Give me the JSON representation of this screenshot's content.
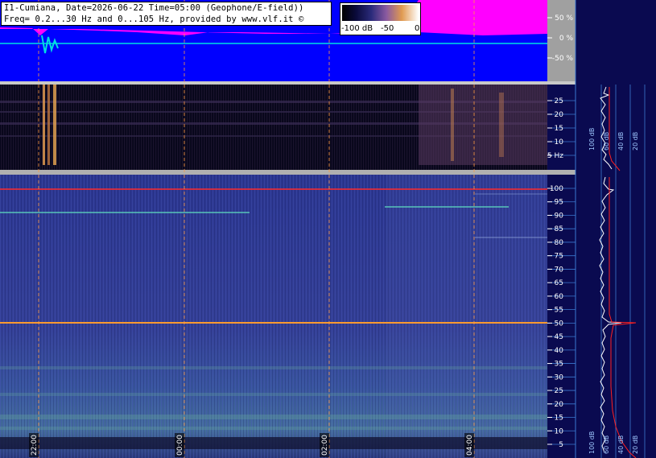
{
  "header": {
    "line1": "I1-Cumiana, Date=2026-06-22 Time=05:00 (Geophone/E-field))",
    "line2": "Freq= 0.2...30 Hz and 0...105 Hz, provided by www.vlf.it ©"
  },
  "colorbar": {
    "labels": [
      "-100 dB",
      "-50",
      "0"
    ]
  },
  "chart_data": [
    {
      "type": "line",
      "panel": "time-domain amplitude",
      "y_ticks": [
        "50 %",
        "0 %",
        "-50 %"
      ],
      "ylim": [
        -100,
        100
      ],
      "colors": {
        "background": "#0000ff",
        "envelope": "#ff00ff",
        "trace": "#00e0e0"
      }
    },
    {
      "type": "heatmap",
      "panel": "spectrogram 0.2-30 Hz",
      "y_ticks": [
        "25",
        "20",
        "15",
        "10",
        "5 Hz"
      ],
      "ylim": [
        0.2,
        30
      ]
    },
    {
      "type": "heatmap",
      "panel": "spectrogram 0-105 Hz",
      "y_ticks": [
        "100",
        "95",
        "90",
        "85",
        "80",
        "75",
        "70",
        "65",
        "60",
        "55",
        "50",
        "45",
        "40",
        "35",
        "30",
        "25",
        "20",
        "15",
        "10",
        "5"
      ],
      "ylim": [
        0,
        105
      ],
      "x_ticks": [
        "22:00",
        "00:00",
        "02:00",
        "04:00"
      ],
      "colors": {
        "background": "#2e3a8c",
        "line_100hz": "#ff2020",
        "line_50hz": "#ffaa30",
        "lines_other": "#60e0c0"
      }
    },
    {
      "type": "line",
      "panel": "average spectrum",
      "x_ticks": [
        "100 dB",
        "60 dB",
        "40 dB",
        "20 dB"
      ],
      "colors": {
        "background": "#0a0a50",
        "grid": "#3b78d0",
        "spectrum": "#ffffff",
        "fit": "#ff2020"
      }
    }
  ]
}
